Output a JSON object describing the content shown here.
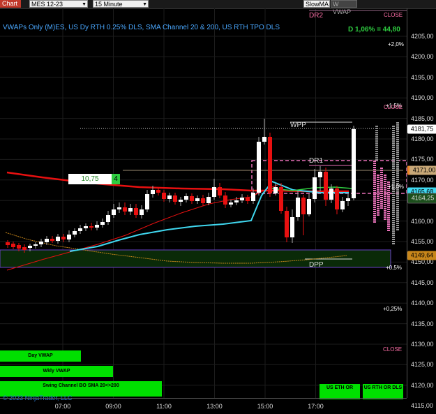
{
  "toolbar": {
    "chart_tab": "Chart",
    "symbol": "MES 12-23",
    "interval": "15 Minute",
    "slow_ma": "SlowMA",
    "wvwap": "W VWAP"
  },
  "study_title": "VWAPs Only (M)ES, US Dy RTH 0.25% DLS, SMA Channel 20 & 200, US RTH TPO DLS",
  "d_readout": "D 1,06% = 44,80",
  "levels": {
    "dr2": "DR2",
    "wpp": "WPP",
    "dr1": "DR1",
    "dpp": "DPP"
  },
  "percent_labels": {
    "p2": "+2,0%",
    "p15": "+1,5%",
    "p10": "+1,0%",
    "p05": "+0,5%",
    "p025": "+0,25%"
  },
  "close_labels": {
    "c1": "CLOSE",
    "c2": "CLOSE",
    "c3": "CLOSE"
  },
  "vwap_box": {
    "value": "10,75",
    "count": "4"
  },
  "buttons": {
    "day_vwap": "Day VWAP",
    "wkly_vwap": "Wkly VWAP",
    "swing_channel": "Swing Channel BO SMA 20<>200",
    "us_eth_or": "US ETH OR",
    "us_rth_or_dls": "US RTH OR DLS"
  },
  "copyright": "© 2023 NinjaTrader, LLC",
  "price_axis": {
    "ticks": [
      "4205,00",
      "4200,00",
      "4195,00",
      "4190,00",
      "4185,00",
      "4180,00",
      "4175,00",
      "4170,00",
      "4165,00",
      "4160,00",
      "4155,00",
      "4150,00",
      "4145,00",
      "4140,00",
      "4135,00",
      "4130,00",
      "4125,00",
      "4120,00",
      "4115,00"
    ],
    "boxes": {
      "last": "4181,75",
      "dr1": "4171,00",
      "vwap": "4165,68",
      "wpp": "4164,25",
      "dpp": "4149,64"
    }
  },
  "time_axis": [
    "07:00",
    "09:00",
    "11:00",
    "13:00",
    "15:00",
    "17:00"
  ],
  "colors": {
    "bull": "#ffffff",
    "bear": "#e81010",
    "sma_fast": "#e81010",
    "sma_slow": "#c8861a",
    "vwap": "#40d8f0",
    "green_line": "#2ecc40",
    "tpo": "#e870b8"
  }
}
